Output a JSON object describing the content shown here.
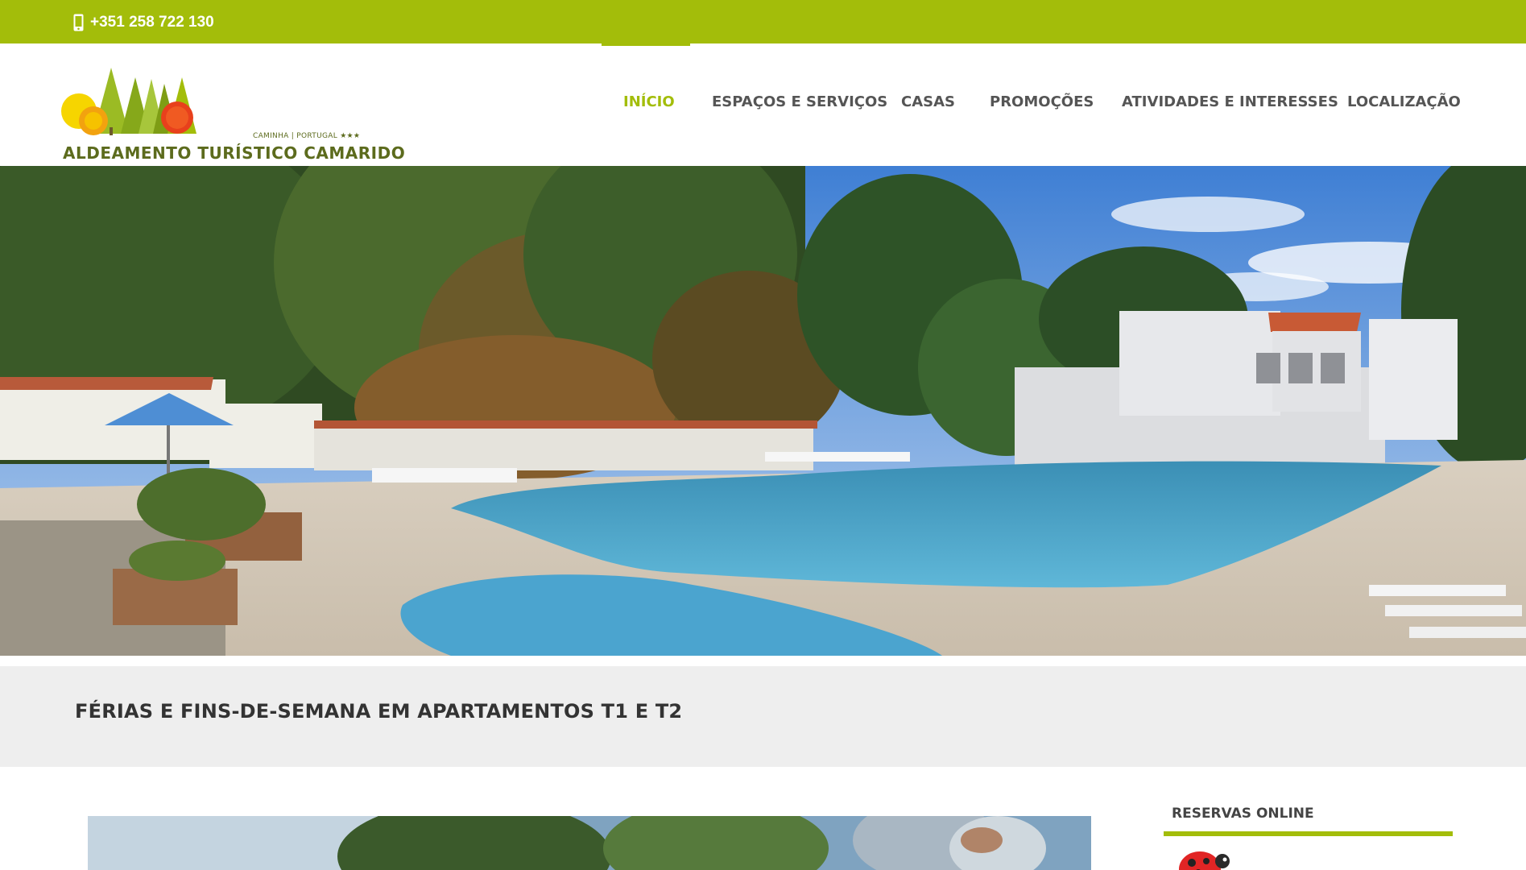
{
  "topbar": {
    "phone": "+351 258 722 130",
    "phone_icon": "mobile-phone-icon",
    "color": "#a3bd0a"
  },
  "logo": {
    "name": "ALDEAMENTO TURÍSTICO CAMARIDO",
    "subtitle": "CAMINHA | PORTUGAL",
    "stars": "★★★"
  },
  "nav": {
    "items": [
      {
        "label": "INÍCIO",
        "active": true
      },
      {
        "label": "ESPAÇOS E SERVIÇOS",
        "active": false
      },
      {
        "label": "CASAS",
        "active": false
      },
      {
        "label": "PROMOÇÕES",
        "active": false
      },
      {
        "label": "ATIVIDADES E INTERESSES",
        "active": false
      },
      {
        "label": "LOCALIZAÇÃO",
        "active": false
      }
    ],
    "accent": "#a3bd0a"
  },
  "hero": {
    "image": "pool-and-garden-photo"
  },
  "banner": {
    "heading": "FÉRIAS E FINS-DE-SEMANA EM APARTAMENTOS T1 E T2"
  },
  "sidebar": {
    "title": "RESERVAS ONLINE",
    "icon": "ladybug-icon"
  }
}
